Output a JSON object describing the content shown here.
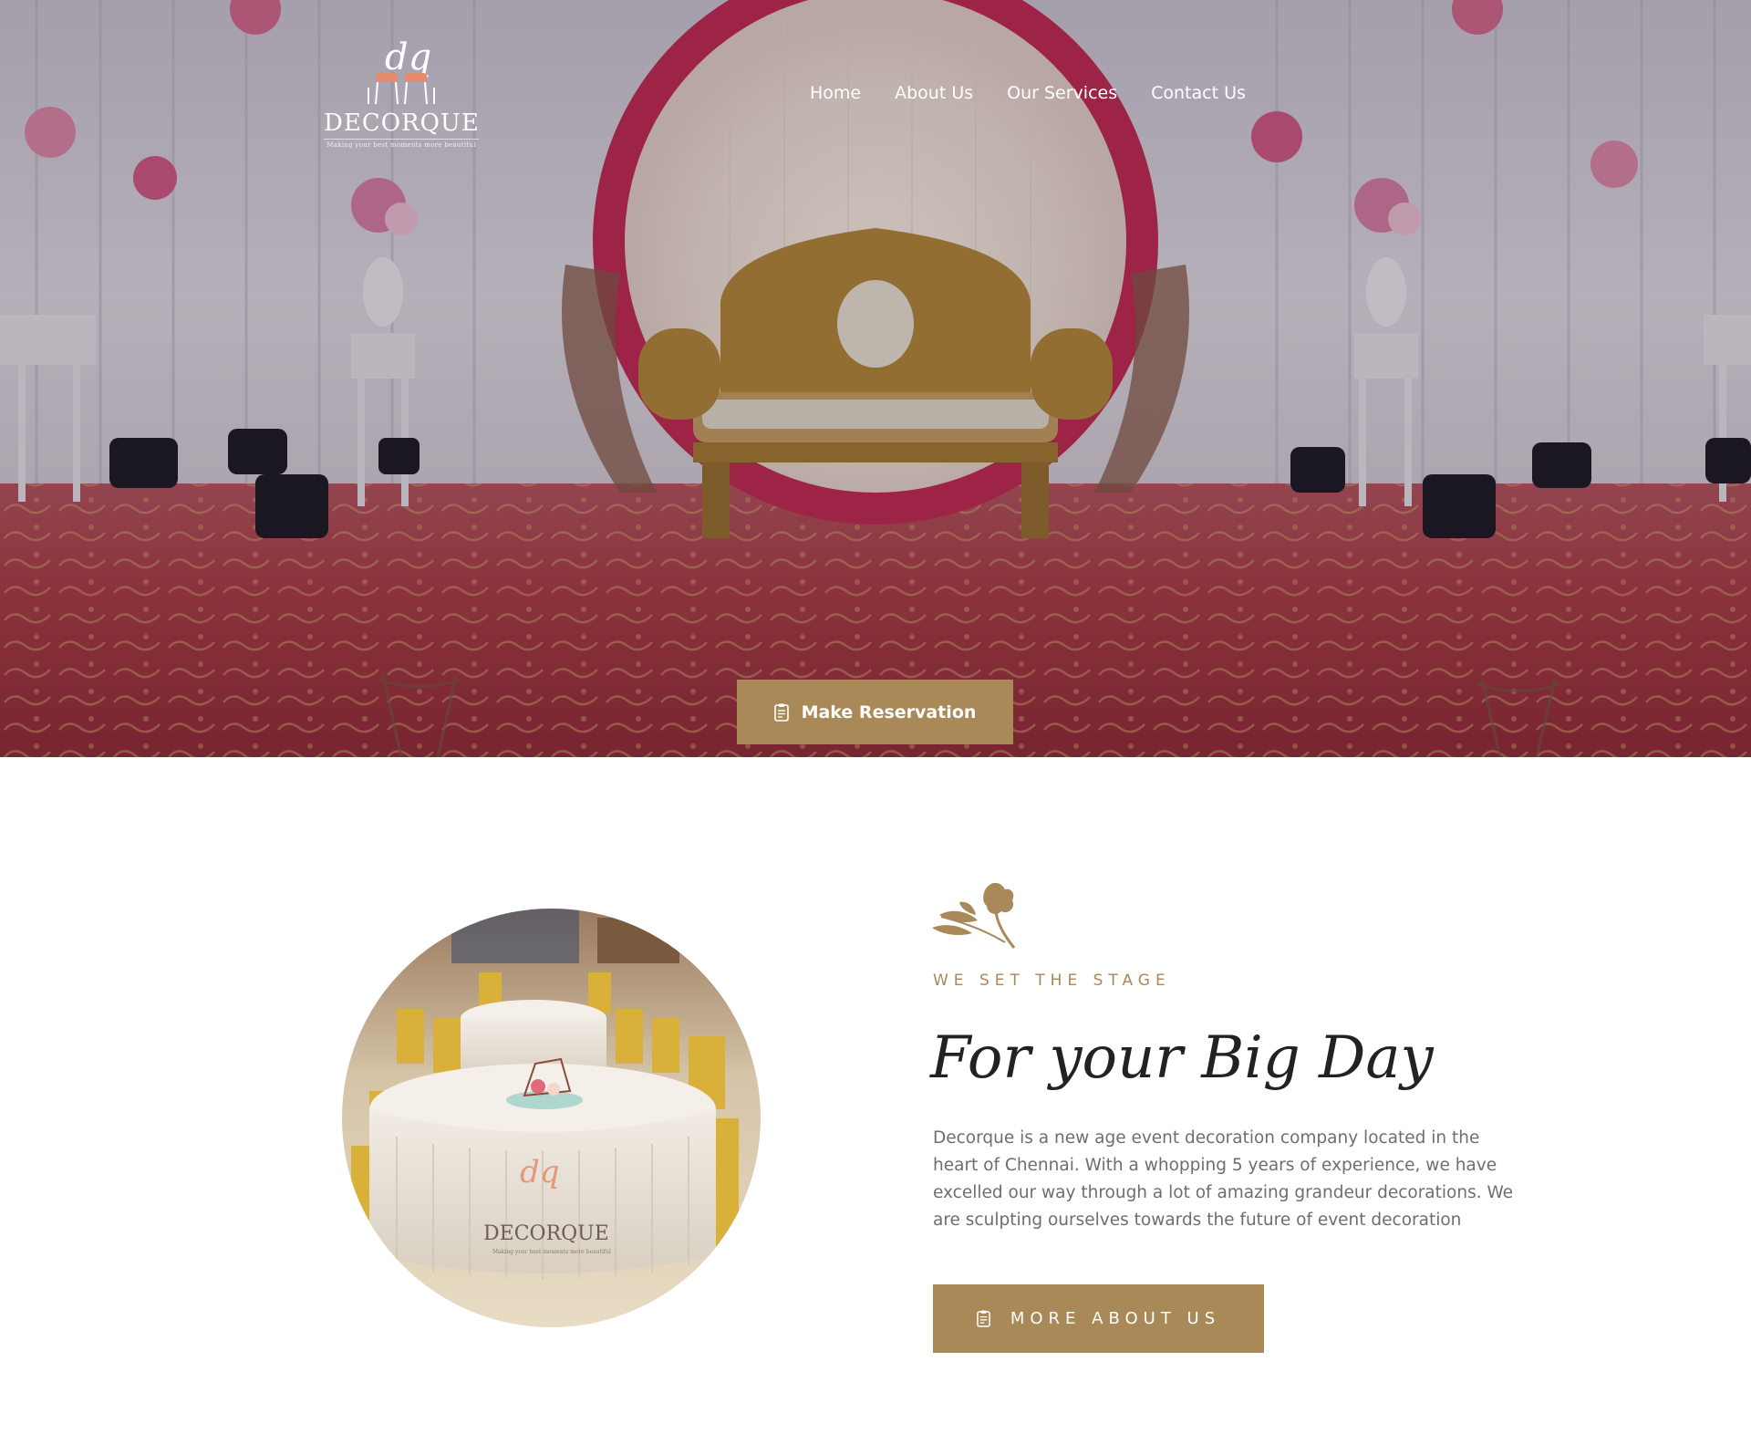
{
  "brand": {
    "name": "DECORQUE",
    "tagline": "Making your best moments more beautiful"
  },
  "nav": {
    "items": [
      {
        "label": "Home"
      },
      {
        "label": "About Us"
      },
      {
        "label": "Our Services"
      },
      {
        "label": "Contact Us"
      }
    ]
  },
  "hero": {
    "cta_label": "Make Reservation",
    "cta_icon": "clipboard-icon"
  },
  "about": {
    "eyebrow": "WE SET THE STAGE",
    "title": "For your Big Day",
    "body": "Decorque is a new age event decoration company located in the heart of Chennai. With a whopping 5 years of experience, we have excelled our way through a lot of amazing grandeur decorations. We are sculpting ourselves towards the future of event decoration",
    "button_label": "MORE ABOUT US",
    "button_icon": "clipboard-icon",
    "decor_icon": "flower-icon",
    "photo_watermark": "DECORQUE",
    "photo_watermark_tagline": "Making your best moments more beautiful"
  },
  "colors": {
    "accent": "#a88957",
    "body_text": "#6e6e6e",
    "heading": "#222222",
    "carpet": "#a93840",
    "arch": "#c42b55"
  }
}
